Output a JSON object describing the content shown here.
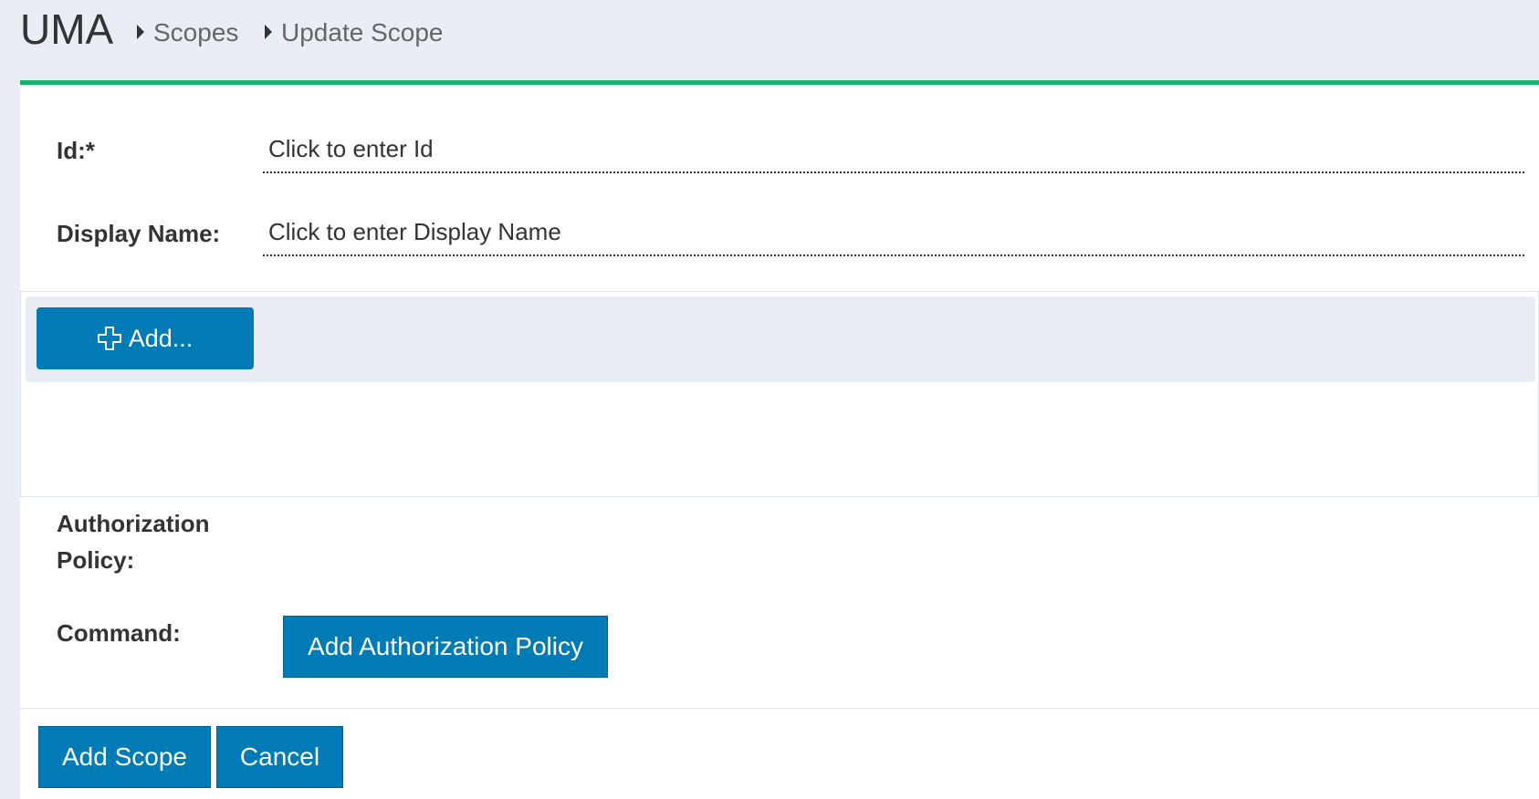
{
  "header": {
    "app_title": "UMA",
    "breadcrumbs": [
      "Scopes",
      "Update Scope"
    ]
  },
  "colors": {
    "accent_green": "#17b26a",
    "button_blue": "#007bb6",
    "header_bg": "#e9eef5"
  },
  "form": {
    "id_label": "Id:*",
    "id_placeholder": "Click to enter Id",
    "display_name_label": "Display Name:",
    "display_name_placeholder": "Click to enter Display Name",
    "grid_add_label": "Add...",
    "authorization_policy_label_line1": "Authorization",
    "authorization_policy_label_line2": "Policy:",
    "command_label": "Command:",
    "add_authorization_policy_label": "Add Authorization Policy"
  },
  "footer": {
    "add_scope_label": "Add Scope",
    "cancel_label": "Cancel"
  },
  "icons": {
    "breadcrumb_separator": "caret-right-icon",
    "add": "plus-icon"
  }
}
